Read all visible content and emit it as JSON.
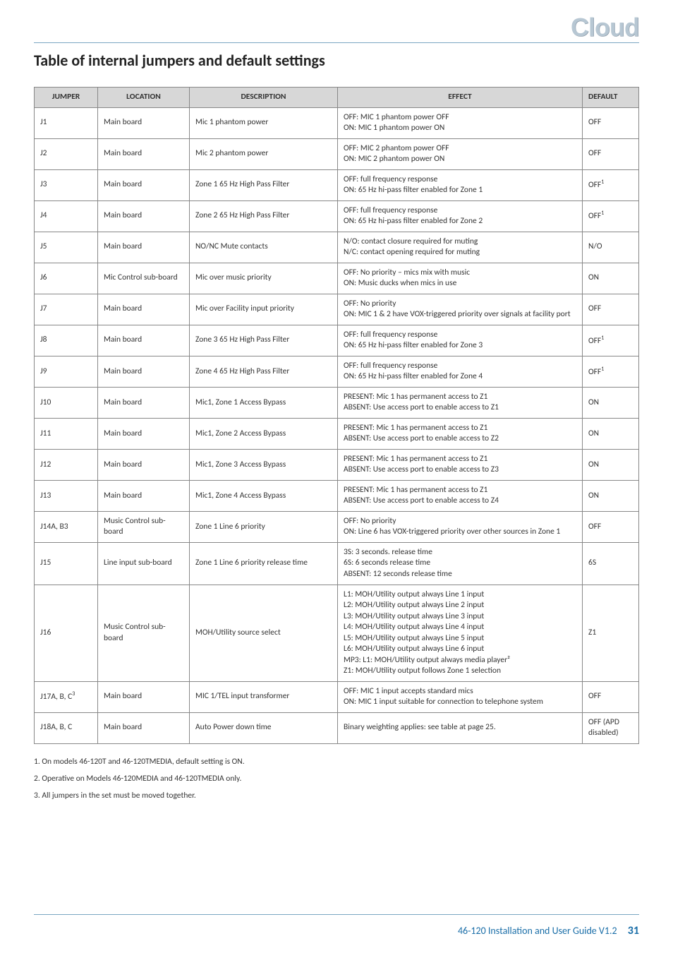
{
  "brand": "Cloud",
  "title": "Table of internal jumpers and default settings",
  "columns": [
    "JUMPER",
    "LOCATION",
    "DESCRIPTION",
    "EFFECT",
    "DEFAULT"
  ],
  "superscripts": {
    "off1": "1",
    "c3": "3",
    "player2": "2"
  },
  "rows": [
    {
      "jumper": "J1",
      "location": "Main board",
      "description": "Mic 1 phantom power",
      "effect_lines": [
        "OFF: MIC 1 phantom power OFF",
        "ON: MIC 1 phantom power ON"
      ],
      "default": "OFF"
    },
    {
      "jumper": "J2",
      "location": "Main board",
      "description": "Mic 2 phantom power",
      "effect_lines": [
        "OFF: MIC 2 phantom power OFF",
        "ON: MIC 2 phantom power ON"
      ],
      "default": "OFF"
    },
    {
      "jumper": "J3",
      "location": "Main board",
      "description": "Zone 1 65 Hz High Pass Filter",
      "effect_lines": [
        "OFF: full frequency response",
        "ON: 65 Hz hi-pass filter enabled for Zone 1"
      ],
      "default": "OFF",
      "default_sup": "1"
    },
    {
      "jumper": "J4",
      "location": "Main board",
      "description": "Zone 2 65 Hz High Pass Filter",
      "effect_lines": [
        "OFF: full frequency response",
        "ON: 65 Hz hi-pass filter enabled for Zone 2"
      ],
      "default": "OFF",
      "default_sup": "1"
    },
    {
      "jumper": "J5",
      "location": "Main board",
      "description": "NO/NC Mute contacts",
      "effect_lines": [
        "N/O: contact closure required for muting",
        "N/C: contact opening required for muting"
      ],
      "default": "N/O"
    },
    {
      "jumper": "J6",
      "location": "Mic Control sub-board",
      "description": "Mic over music priority",
      "effect_lines": [
        "OFF: No priority – mics mix with music",
        "ON: Music ducks when mics in use"
      ],
      "default": "ON"
    },
    {
      "jumper": "J7",
      "location": "Main board",
      "description": "Mic over Facility input priority",
      "effect_lines": [
        "OFF: No priority",
        "ON: MIC 1 & 2 have VOX-triggered priority over signals at facility port"
      ],
      "default": "OFF"
    },
    {
      "jumper": "J8",
      "location": "Main board",
      "description": "Zone 3 65 Hz High Pass Filter",
      "effect_lines": [
        "OFF: full frequency response",
        "ON: 65 Hz hi-pass filter enabled for Zone 3"
      ],
      "default": "OFF",
      "default_sup": "1"
    },
    {
      "jumper": "J9",
      "location": "Main board",
      "description": "Zone 4 65 Hz High Pass Filter",
      "effect_lines": [
        "OFF: full frequency response",
        "ON: 65 Hz hi-pass filter enabled for Zone 4"
      ],
      "default": "OFF",
      "default_sup": "1"
    },
    {
      "jumper": "J10",
      "location": "Main board",
      "description": "Mic1, Zone 1 Access Bypass",
      "effect_lines": [
        "PRESENT: Mic 1 has permanent access to Z1",
        "ABSENT: Use access port to enable access to Z1"
      ],
      "default": "ON"
    },
    {
      "jumper": "J11",
      "location": "Main board",
      "description": "Mic1, Zone 2 Access Bypass",
      "effect_lines": [
        "PRESENT: Mic 1 has permanent access to Z1",
        "ABSENT: Use access port to enable access to Z2"
      ],
      "default": "ON"
    },
    {
      "jumper": "J12",
      "location": "Main board",
      "description": "Mic1, Zone 3 Access Bypass",
      "effect_lines": [
        "PRESENT: Mic 1 has permanent access to Z1",
        "ABSENT: Use access port to enable access to Z3"
      ],
      "default": "ON"
    },
    {
      "jumper": "J13",
      "location": "Main board",
      "description": "Mic1, Zone 4 Access Bypass",
      "effect_lines": [
        "PRESENT: Mic 1 has permanent access to Z1",
        "ABSENT: Use access port to enable access to Z4"
      ],
      "default": "ON"
    },
    {
      "jumper": "J14A, B3",
      "location": "Music Control sub-board",
      "description": "Zone 1 Line 6 priority",
      "effect_lines": [
        "OFF: No priority",
        "ON: Line 6 has VOX-triggered priority over other sources in Zone 1"
      ],
      "default": "OFF"
    },
    {
      "jumper": "J15",
      "location": "Line input sub-board",
      "description": "Zone 1 Line 6 priority release time",
      "effect_lines": [
        "3S: 3 seconds. release time",
        "6S: 6 seconds release time",
        "ABSENT: 12 seconds release time"
      ],
      "default": "6S"
    },
    {
      "jumper": "J16",
      "location": "Music Control sub-board",
      "description": "MOH/Utility source select",
      "effect_lines": [
        "L1: MOH/Utility output always Line 1 input",
        "L2: MOH/Utility output always Line 2 input",
        "L3: MOH/Utility output always Line 3 input",
        "L4: MOH/Utility output always Line 4 input",
        "L5: MOH/Utility output always Line 5 input",
        "L6: MOH/Utility output always Line 6 input",
        "MP3: L1: MOH/Utility output always media player²",
        "Z1: MOH/Utility output follows Zone 1 selection"
      ],
      "default": "Z1"
    },
    {
      "jumper": "J17A, B, C",
      "jumper_sup": "3",
      "location": "Main board",
      "description": "MIC 1/TEL input transformer",
      "effect_lines": [
        "OFF: MIC 1 input accepts standard mics",
        "ON: MIC 1 input suitable for connection to telephone system"
      ],
      "default": "OFF"
    },
    {
      "jumper": "J18A, B, C",
      "location": "Main board",
      "description": "Auto Power down time",
      "effect_lines": [
        "Binary weighting applies: see table at page 25."
      ],
      "default": "OFF (APD disabled)"
    }
  ],
  "notes": [
    "1. On models 46-120T and 46-120TMEDIA, default setting is ON.",
    "2. Operative on Models 46-120MEDIA and 46-120TMEDIA only.",
    "3. All jumpers in the set must be moved together."
  ],
  "footer": {
    "doc": "46-120 Installation and User Guide V1.2",
    "page": "31"
  }
}
